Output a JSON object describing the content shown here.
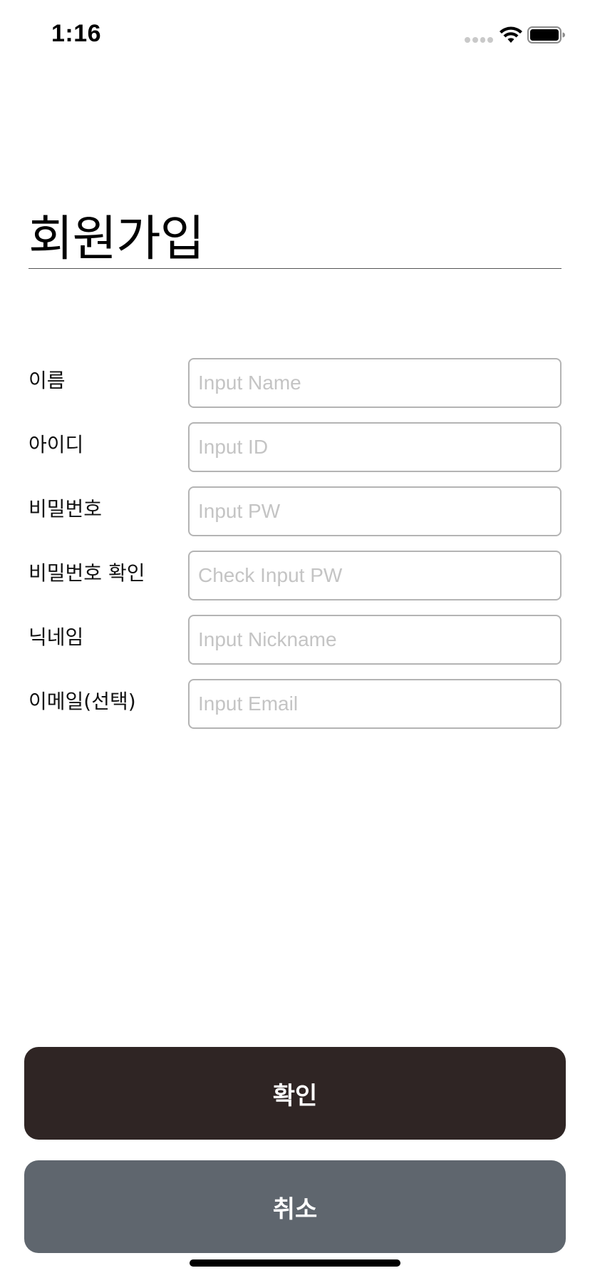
{
  "status_bar": {
    "time": "1:16"
  },
  "title": "회원가입",
  "form": {
    "fields": [
      {
        "label": "이름",
        "placeholder": "Input Name",
        "value": ""
      },
      {
        "label": "아이디",
        "placeholder": "Input ID",
        "value": ""
      },
      {
        "label": "비밀번호",
        "placeholder": "Input PW",
        "value": ""
      },
      {
        "label": "비밀번호 확인",
        "placeholder": "Check Input PW",
        "value": ""
      },
      {
        "label": "닉네임",
        "placeholder": "Input Nickname",
        "value": ""
      },
      {
        "label": "이메일(선택)",
        "placeholder": "Input Email",
        "value": ""
      }
    ]
  },
  "buttons": {
    "confirm_label": "확인",
    "cancel_label": "취소"
  },
  "colors": {
    "confirm_button": "#2f2524",
    "cancel_button": "#5f666e",
    "divider": "#555555",
    "input_border": "#b4b4b4",
    "placeholder": "#c4c4c4"
  },
  "icons": [
    "cellular-signal-icon",
    "wifi-icon",
    "battery-icon"
  ]
}
